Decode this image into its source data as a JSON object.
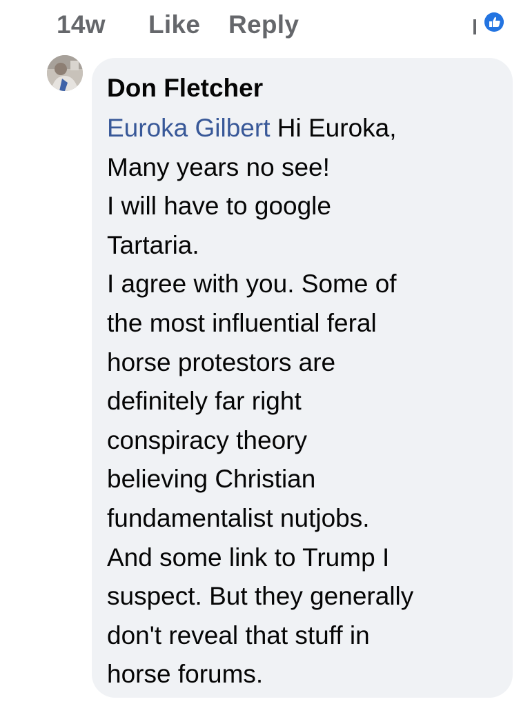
{
  "actions": {
    "time": "14w",
    "like": "Like",
    "reply": "Reply"
  },
  "comment": {
    "author": "Don Fletcher",
    "mention": "Euroka Gilbert",
    "lines": [
      " Hi Euroka,",
      "Many years no see!",
      "I will have to google",
      "Tartaria.",
      "I agree with you. Some of",
      "the most influential feral",
      "horse protestors are",
      "definitely far right",
      "conspiracy theory",
      "believing Christian",
      "fundamentalist nutjobs.",
      "And some link to Trump I",
      "suspect. But they generally",
      "don't reveal that stuff in",
      "horse forums."
    ]
  },
  "colors": {
    "bubble": "#f0f2f5",
    "mention": "#385898",
    "meta_text": "#65676b",
    "reaction": "#2374e1"
  },
  "icons": {
    "reaction": "reaction-icon",
    "avatar": "avatar"
  }
}
